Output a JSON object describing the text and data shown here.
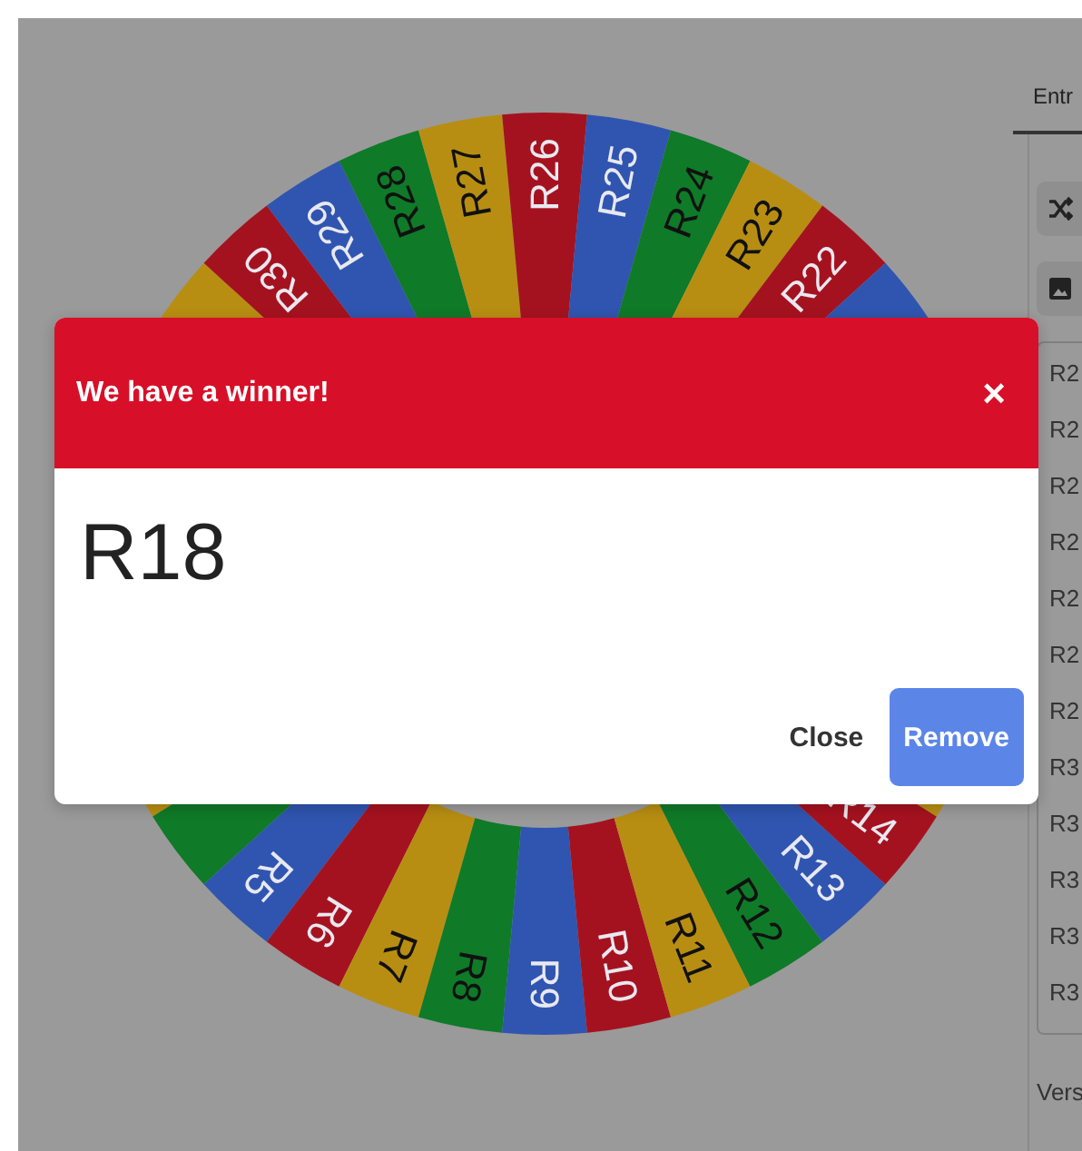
{
  "wheel": {
    "top_segments": [
      {
        "color": "#b88e12"
      },
      {
        "label": "R30",
        "color": "#a5121f"
      },
      {
        "label": "R29",
        "color": "#2f55b0"
      },
      {
        "label": "R28",
        "color": "#0f7a28"
      },
      {
        "label": "R27",
        "color": "#b88e12"
      },
      {
        "label": "R26",
        "color": "#a5121f"
      },
      {
        "label": "R25",
        "color": "#2f55b0"
      },
      {
        "label": "R24",
        "color": "#0f7a28"
      },
      {
        "label": "R23",
        "color": "#b88e12"
      },
      {
        "label": "R22",
        "color": "#a5121f"
      },
      {
        "color": "#2f55b0"
      }
    ],
    "bottom_segments": [
      {
        "color": "#b88e12"
      },
      {
        "color": "#0f7a28"
      },
      {
        "label": "R5",
        "color": "#2f55b0"
      },
      {
        "label": "R6",
        "color": "#a5121f"
      },
      {
        "label": "R7",
        "color": "#b88e12"
      },
      {
        "label": "R8",
        "color": "#0f7a28"
      },
      {
        "label": "R9",
        "color": "#2f55b0"
      },
      {
        "label": "R10",
        "color": "#a5121f"
      },
      {
        "label": "R11",
        "color": "#b88e12"
      },
      {
        "label": "R12",
        "color": "#0f7a28"
      },
      {
        "label": "R13",
        "color": "#2f55b0"
      },
      {
        "label": "R14",
        "color": "#a5121f"
      },
      {
        "color": "#b88e12"
      }
    ]
  },
  "side_panel": {
    "tab": "Entr",
    "entries": [
      "R2",
      "R2",
      "R2",
      "R2",
      "R2",
      "R2",
      "R2",
      "R3",
      "R3",
      "R3",
      "R3",
      "R3"
    ],
    "footer": "Vers"
  },
  "dialog": {
    "title": "We have a winner!",
    "close_icon": "×",
    "winner": "R18",
    "buttons": [
      {
        "label": "Close",
        "kind": "text"
      },
      {
        "label": "Remove",
        "kind": "primary"
      }
    ]
  }
}
